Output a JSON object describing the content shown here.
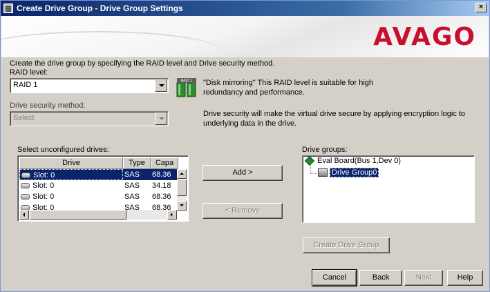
{
  "window": {
    "title": "Create Drive Group - Drive Group Settings",
    "close_label": "×",
    "logo": "AVAGO"
  },
  "form": {
    "intro": "Create the drive group by specifying the RAID level and Drive security method.",
    "raid_level_label": "RAID level:",
    "raid_level_value": "RAID 1",
    "raid_description_line1": "\"Disk mirroring\" This RAID level is suitable for high",
    "raid_description_line2": "redundancy and performance.",
    "security_label": "Drive security method:",
    "security_value": "Select",
    "security_description_line1": "Drive security will make the virtual drive secure by applying encryption logic to",
    "security_description_line2": "underlying data in the drive.",
    "raid_icon_text": "RAID 1"
  },
  "unconfigured": {
    "label": "Select unconfigured drives:",
    "columns": [
      "Drive",
      "Type",
      "Capa"
    ],
    "rows": [
      {
        "drive": "Slot: 0",
        "type": "SAS",
        "capacity": "68.36"
      },
      {
        "drive": "Slot: 0",
        "type": "SAS",
        "capacity": "34.18"
      },
      {
        "drive": "Slot: 0",
        "type": "SAS",
        "capacity": "68.36"
      },
      {
        "drive": "Slot: 0",
        "type": "SAS",
        "capacity": "68.36"
      }
    ]
  },
  "actions": {
    "add": "Add >",
    "remove": "< Remove",
    "create_group": "Create Drive Group"
  },
  "drive_groups": {
    "label": "Drive groups:",
    "root": "Eval Board(Bus 1,Dev 0)",
    "child": "Drive Group0"
  },
  "footer": {
    "cancel": "Cancel",
    "back": "Back",
    "next": "Next",
    "help": "Help"
  },
  "colors": {
    "selection": "#0a246a",
    "logo": "#c8102e",
    "tree_icon": "#1e8a2e"
  }
}
